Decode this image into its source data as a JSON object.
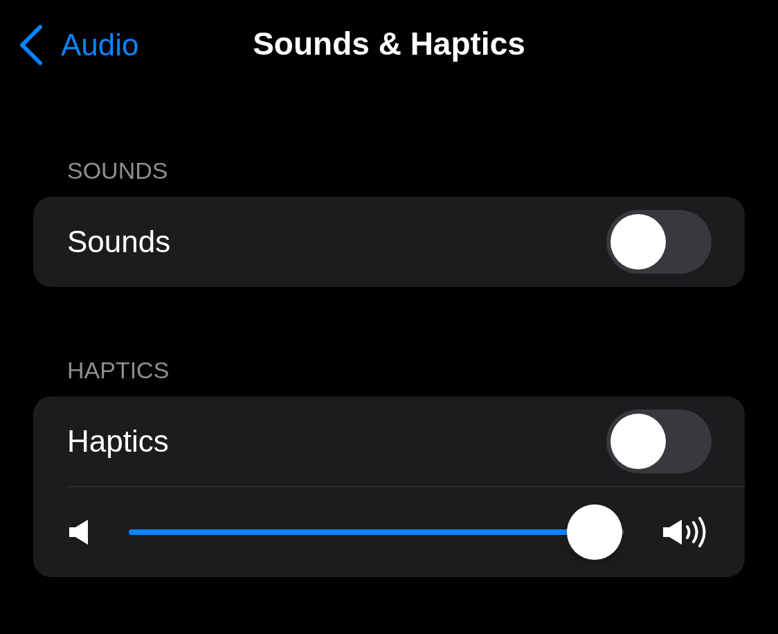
{
  "nav": {
    "back_label": "Audio",
    "title": "Sounds & Haptics"
  },
  "sections": [
    {
      "header": "SOUNDS",
      "rows": [
        {
          "kind": "toggle",
          "label": "Sounds",
          "on": false
        }
      ]
    },
    {
      "header": "HAPTICS",
      "rows": [
        {
          "kind": "toggle",
          "label": "Haptics",
          "on": false
        },
        {
          "kind": "slider",
          "level": 0.94
        }
      ]
    }
  ]
}
